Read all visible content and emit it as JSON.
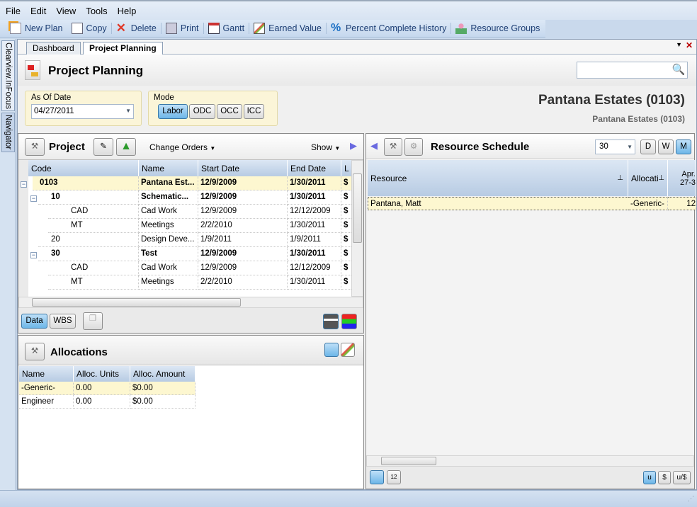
{
  "menu": [
    "File",
    "Edit",
    "View",
    "Tools",
    "Help"
  ],
  "toolbar": [
    {
      "label": "New Plan",
      "icon": "new-plan-icon"
    },
    {
      "label": "Copy",
      "icon": "copy-icon"
    },
    {
      "label": "Delete",
      "icon": "delete-x-icon"
    },
    {
      "label": "Print",
      "icon": "printer-icon"
    },
    {
      "label": "Gantt",
      "icon": "gantt-icon"
    },
    {
      "label": "Earned Value",
      "icon": "chart-icon"
    },
    {
      "label": "Percent Complete History",
      "icon": "percent-icon"
    },
    {
      "label": "Resource Groups",
      "icon": "people-icon"
    }
  ],
  "side_tabs": [
    "Clearview.InFocus",
    "Navigator"
  ],
  "tabs": [
    "Dashboard",
    "Project Planning"
  ],
  "page_title": "Project Planning",
  "search": {
    "value": "",
    "placeholder": ""
  },
  "as_of_date": {
    "label": "As Of Date",
    "value": "04/27/2011"
  },
  "mode": {
    "label": "Mode",
    "options": [
      "Labor",
      "ODC",
      "OCC",
      "ICC"
    ],
    "selected": "Labor"
  },
  "project_title": "Pantana Estates (0103)",
  "project_subtitle": "Pantana Estates (0103)",
  "project_panel": {
    "title": "Project",
    "change_orders": "Change Orders",
    "show": "Show",
    "columns": [
      "Code",
      "Name",
      "Start Date",
      "End Date",
      "L"
    ],
    "rows": [
      {
        "code": "0103",
        "name": "Pantana Est...",
        "start": "12/9/2009",
        "end": "1/30/2011",
        "l": "$",
        "bold": true,
        "level": 0,
        "expander": true,
        "selected": true
      },
      {
        "code": "10",
        "name": "Schematic...",
        "start": "12/9/2009",
        "end": "1/30/2011",
        "l": "$",
        "bold": true,
        "level": 1,
        "expander": true
      },
      {
        "code": "CAD",
        "name": "Cad Work",
        "start": "12/9/2009",
        "end": "12/12/2009",
        "l": "$",
        "level": 2
      },
      {
        "code": "MT",
        "name": "Meetings",
        "start": "2/2/2010",
        "end": "1/30/2011",
        "l": "$",
        "level": 2
      },
      {
        "code": "20",
        "name": "Design Deve...",
        "start": "1/9/2011",
        "end": "1/9/2011",
        "l": "$",
        "level": 1
      },
      {
        "code": "30",
        "name": "Test",
        "start": "12/9/2009",
        "end": "1/30/2011",
        "l": "$",
        "bold": true,
        "level": 1,
        "expander": true
      },
      {
        "code": "CAD",
        "name": "Cad Work",
        "start": "12/9/2009",
        "end": "12/12/2009",
        "l": "$",
        "level": 2
      },
      {
        "code": "MT",
        "name": "Meetings",
        "start": "2/2/2010",
        "end": "1/30/2011",
        "l": "$",
        "level": 2
      }
    ],
    "view_buttons": [
      "Data",
      "WBS"
    ],
    "view_selected": "Data"
  },
  "allocations": {
    "title": "Allocations",
    "columns": [
      "Name",
      "Alloc. Units",
      "Alloc. Amount"
    ],
    "rows": [
      [
        "-Generic-",
        "0.00",
        "$0.00"
      ],
      [
        "Engineer",
        "0.00",
        "$0.00"
      ]
    ]
  },
  "resource_schedule": {
    "title": "Resource Schedule",
    "period": "30",
    "scale_buttons": [
      "D",
      "W",
      "M"
    ],
    "scale_selected": "M",
    "columns": [
      "Resource",
      "Allocati",
      "Apr.\n27-3"
    ],
    "rows": [
      [
        "Pantana, Matt",
        "-Generic-",
        "12"
      ]
    ],
    "unit_buttons": [
      "u",
      "$",
      "u/$"
    ],
    "unit_selected": "u"
  }
}
